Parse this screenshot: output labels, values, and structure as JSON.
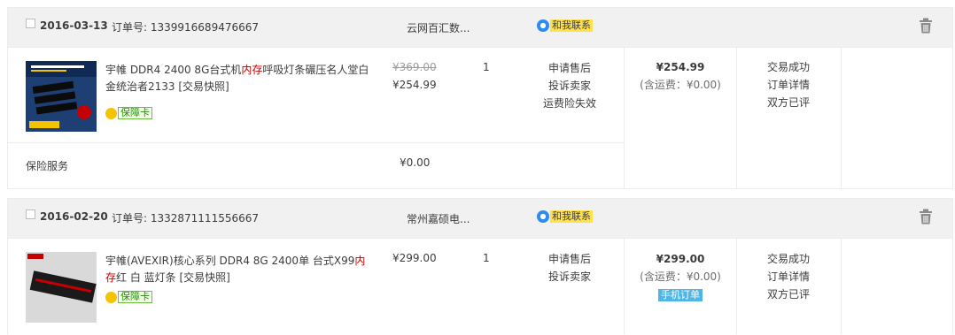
{
  "orders": [
    {
      "date": "2016-03-13",
      "order_no": "订单号: 1339916689476667",
      "shop": "云网百汇数...",
      "contact": "和我联系",
      "item": {
        "title_pre": "宇帷 DDR4 2400 8G台式机",
        "title_hl": "内存",
        "title_post": "呼吸灯条碾压名人堂白金统治者2133 [交易快照]",
        "badge": "保障卡",
        "original_price": "¥369.00",
        "price": "¥254.99",
        "qty": "1",
        "ops": [
          "申请售后",
          "投诉卖家",
          "运费险失效"
        ]
      },
      "total": "¥254.99",
      "shipping": "(含运费：¥0.00)",
      "status": [
        "交易成功",
        "订单详情",
        "双方已评"
      ],
      "insurance_label": "保险服务",
      "insurance_price": "¥0.00"
    },
    {
      "date": "2016-02-20",
      "order_no": "订单号: 1332871111556667",
      "shop": "常州嘉硕电...",
      "contact": "和我联系",
      "item": {
        "title_pre": "宇帷(AVEXIR)核心系列 DDR4 8G 2400单 台式X99",
        "title_hl": "内存",
        "title_post": "红 白 蓝灯条 [交易快照]",
        "badge": "保障卡",
        "price": "¥299.00",
        "qty": "1",
        "ops": [
          "申请售后",
          "投诉卖家"
        ]
      },
      "total": "¥299.00",
      "shipping": "(含运费：¥0.00)",
      "mobile_tag": "手机订单",
      "status": [
        "交易成功",
        "订单详情",
        "双方已评"
      ]
    }
  ]
}
